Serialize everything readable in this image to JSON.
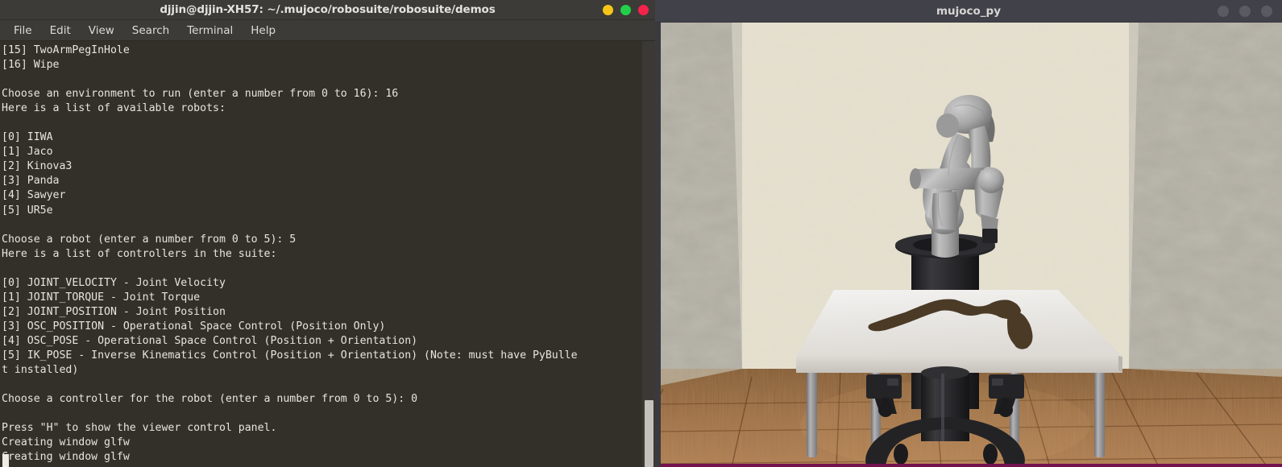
{
  "terminal": {
    "title": "djjin@djjin-XH57: ~/.mujoco/robosuite/robosuite/demos",
    "window_buttons": [
      {
        "name": "minimize",
        "color": "#f5c518"
      },
      {
        "name": "maximize",
        "color": "#22d04a"
      },
      {
        "name": "close",
        "color": "#f5234a"
      }
    ],
    "menu": [
      "File",
      "Edit",
      "View",
      "Search",
      "Terminal",
      "Help"
    ],
    "background_color": "#333029",
    "text_color": "#e8e4de",
    "content": "[15] TwoArmPegInHole\n[16] Wipe\n\nChoose an environment to run (enter a number from 0 to 16): 16\nHere is a list of available robots:\n\n[0] IIWA\n[1] Jaco\n[2] Kinova3\n[3] Panda\n[4] Sawyer\n[5] UR5e\n\nChoose a robot (enter a number from 0 to 5): 5\nHere is a list of controllers in the suite:\n\n[0] JOINT_VELOCITY - Joint Velocity\n[1] JOINT_TORQUE - Joint Torque\n[2] JOINT_POSITION - Joint Position\n[3] OSC_POSITION - Operational Space Control (Position Only)\n[4] OSC_POSE - Operational Space Control (Position + Orientation)\n[5] IK_POSE - Inverse Kinematics Control (Position + Orientation) (Note: must have PyBulle\nt installed)\n\nChoose a controller for the robot (enter a number from 0 to 5): 0\n\nPress \"H\" to show the viewer control panel.\nCreating window glfw\nCreating window glfw",
    "environment_list": [
      {
        "index": "15",
        "name": "TwoArmPegInHole"
      },
      {
        "index": "16",
        "name": "Wipe"
      }
    ],
    "robot_list": [
      {
        "index": "0",
        "name": "IIWA"
      },
      {
        "index": "1",
        "name": "Jaco"
      },
      {
        "index": "2",
        "name": "Kinova3"
      },
      {
        "index": "3",
        "name": "Panda"
      },
      {
        "index": "4",
        "name": "Sawyer"
      },
      {
        "index": "5",
        "name": "UR5e"
      }
    ],
    "controller_list": [
      {
        "index": "0",
        "name": "JOINT_VELOCITY",
        "desc": "Joint Velocity"
      },
      {
        "index": "1",
        "name": "JOINT_TORQUE",
        "desc": "Joint Torque"
      },
      {
        "index": "2",
        "name": "JOINT_POSITION",
        "desc": "Joint Position"
      },
      {
        "index": "3",
        "name": "OSC_POSITION",
        "desc": "Operational Space Control (Position Only)"
      },
      {
        "index": "4",
        "name": "OSC_POSE",
        "desc": "Operational Space Control (Position + Orientation)"
      },
      {
        "index": "5",
        "name": "IK_POSE",
        "desc": "Inverse Kinematics Control (Position + Orientation) (Note: must have PyBullet installed)"
      }
    ],
    "prompts": [
      {
        "question": "Choose an environment to run (enter a number from 0 to 16):",
        "answer": "16"
      },
      {
        "question": "Choose a robot (enter a number from 0 to 5):",
        "answer": "5"
      },
      {
        "question": "Choose a controller for the robot (enter a number from 0 to 5):",
        "answer": "0"
      }
    ],
    "status_lines": [
      "Press \"H\" to show the viewer control panel.",
      "Creating window glfw",
      "Creating window glfw"
    ]
  },
  "mujoco": {
    "title": "mujoco_py",
    "window_buttons": [
      {
        "name": "minimize",
        "color": "#5a5a63"
      },
      {
        "name": "maximize",
        "color": "#5a5a63"
      },
      {
        "name": "close",
        "color": "#5a5a63"
      }
    ],
    "scene": {
      "description": "Robosuite Wipe task with UR5e robot arm over a white table with dirt marks",
      "wall_color": "#cdc7b4",
      "side_wall_color": "#87837a",
      "floor_color": "#8a5a2b",
      "table_top_color": "#eceae6",
      "robot_color": "#a3a3a3",
      "base_color": "#2a2a2c",
      "dirt_color": "#473723",
      "accent_strip_color": "#74124f"
    }
  }
}
